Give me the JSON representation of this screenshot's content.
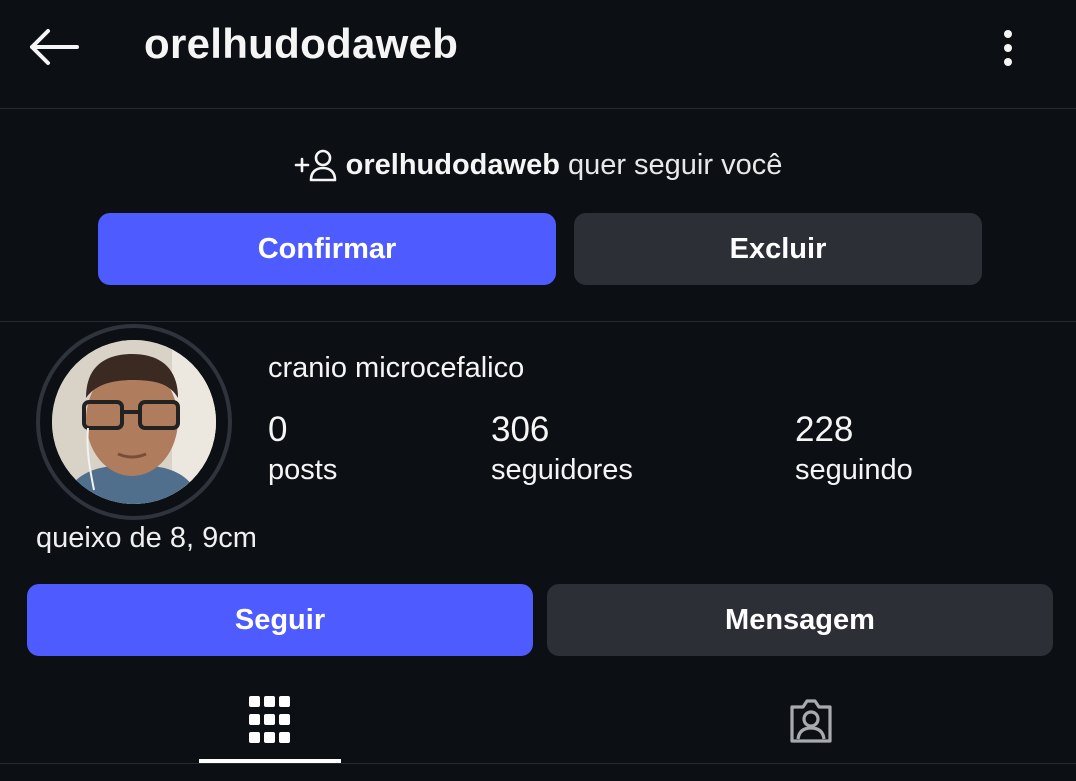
{
  "header": {
    "back_icon": "arrow-left-icon",
    "title": "orelhudodaweb",
    "more_icon": "more-vertical-icon"
  },
  "follow_request": {
    "icon": "add-person-icon",
    "username": "orelhudodaweb",
    "message": "quer seguir você",
    "confirm_label": "Confirmar",
    "delete_label": "Excluir"
  },
  "profile": {
    "display_name": "cranio microcefalico",
    "stats": {
      "posts_count": "0",
      "posts_label": "posts",
      "followers_count": "306",
      "followers_label": "seguidores",
      "following_count": "228",
      "following_label": "seguindo"
    },
    "bio": "queixo de 8, 9cm",
    "follow_label": "Seguir",
    "message_label": "Mensagem"
  },
  "tabs": [
    {
      "icon": "grid-icon",
      "active": true
    },
    {
      "icon": "tagged-person-icon",
      "active": false
    }
  ],
  "colors": {
    "background": "#0c0f14",
    "primary_button": "#4e5bff",
    "secondary_button": "#2c2f36",
    "divider": "#262a31"
  }
}
